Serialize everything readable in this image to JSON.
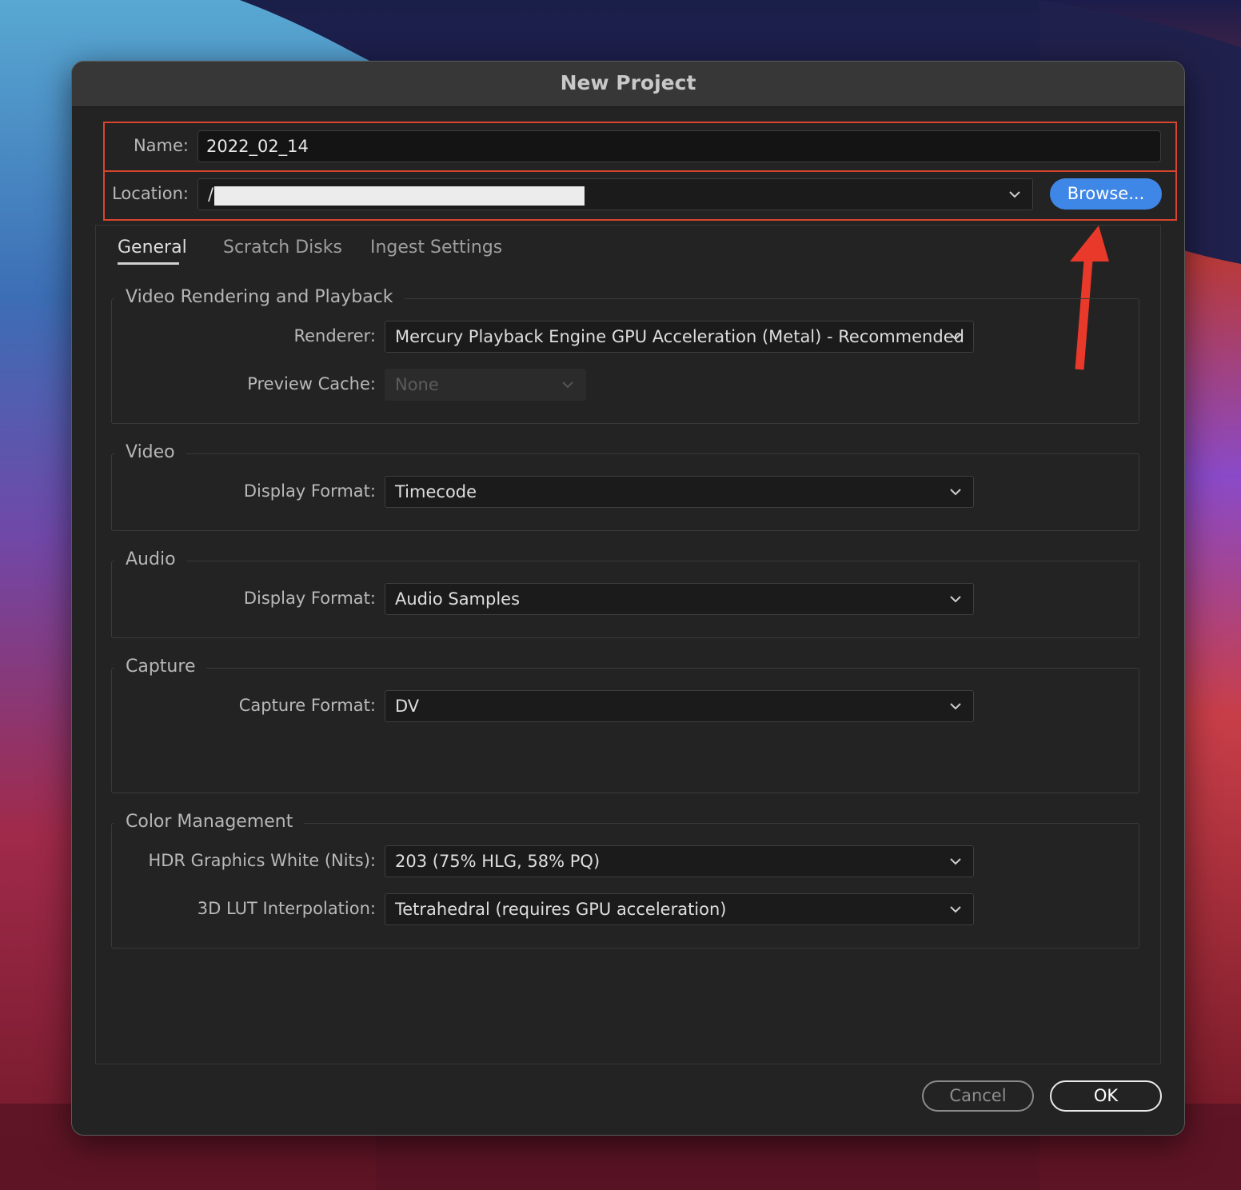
{
  "window": {
    "title": "New Project"
  },
  "project": {
    "name_label": "Name:",
    "name_value": "2022_02_14",
    "location_label": "Location:",
    "location_value": "/",
    "browse_label": "Browse..."
  },
  "tabs": [
    {
      "label": "General",
      "active": true
    },
    {
      "label": "Scratch Disks",
      "active": false
    },
    {
      "label": "Ingest Settings",
      "active": false
    }
  ],
  "sections": {
    "video_rendering": {
      "title": "Video Rendering and Playback",
      "renderer_label": "Renderer:",
      "renderer_value": "Mercury Playback Engine GPU Acceleration (Metal) - Recommended",
      "preview_cache_label": "Preview Cache:",
      "preview_cache_value": "None"
    },
    "video": {
      "title": "Video",
      "display_format_label": "Display Format:",
      "display_format_value": "Timecode"
    },
    "audio": {
      "title": "Audio",
      "display_format_label": "Display Format:",
      "display_format_value": "Audio Samples"
    },
    "capture": {
      "title": "Capture",
      "capture_format_label": "Capture Format:",
      "capture_format_value": "DV"
    },
    "color_management": {
      "title": "Color Management",
      "hdr_label": "HDR Graphics White (Nits):",
      "hdr_value": "203 (75% HLG, 58% PQ)",
      "lut_label": "3D LUT Interpolation:",
      "lut_value": "Tetrahedral (requires GPU acceleration)"
    }
  },
  "buttons": {
    "cancel": "Cancel",
    "ok": "OK"
  },
  "colors": {
    "annotation_red": "#d8452e",
    "primary_blue": "#3f87e6",
    "dialog_background": "#232323"
  },
  "icons": {
    "dropdown": "chevron-down-icon",
    "annotation": "red-arrow-annotation"
  }
}
